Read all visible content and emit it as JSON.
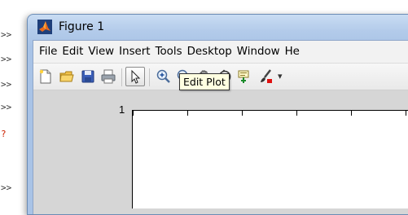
{
  "command_window": {
    "prompt_lines": [
      ">>",
      ">>",
      ">>",
      ">>",
      ">>",
      ">>"
    ],
    "error_marker": "?"
  },
  "window": {
    "title": "Figure 1"
  },
  "menu": [
    "File",
    "Edit",
    "View",
    "Insert",
    "Tools",
    "Desktop",
    "Window",
    "He"
  ],
  "toolbar": {
    "buttons": [
      "new-figure",
      "open-file",
      "save-figure",
      "print-figure",
      "edit-plot",
      "zoom-in",
      "zoom-out",
      "pan",
      "rotate-3d",
      "data-cursor",
      "brush"
    ],
    "active": "edit-plot",
    "more_glyph": "▾"
  },
  "tooltip": {
    "text": "Edit Plot"
  },
  "axes": {
    "y_tick_label": "1"
  }
}
